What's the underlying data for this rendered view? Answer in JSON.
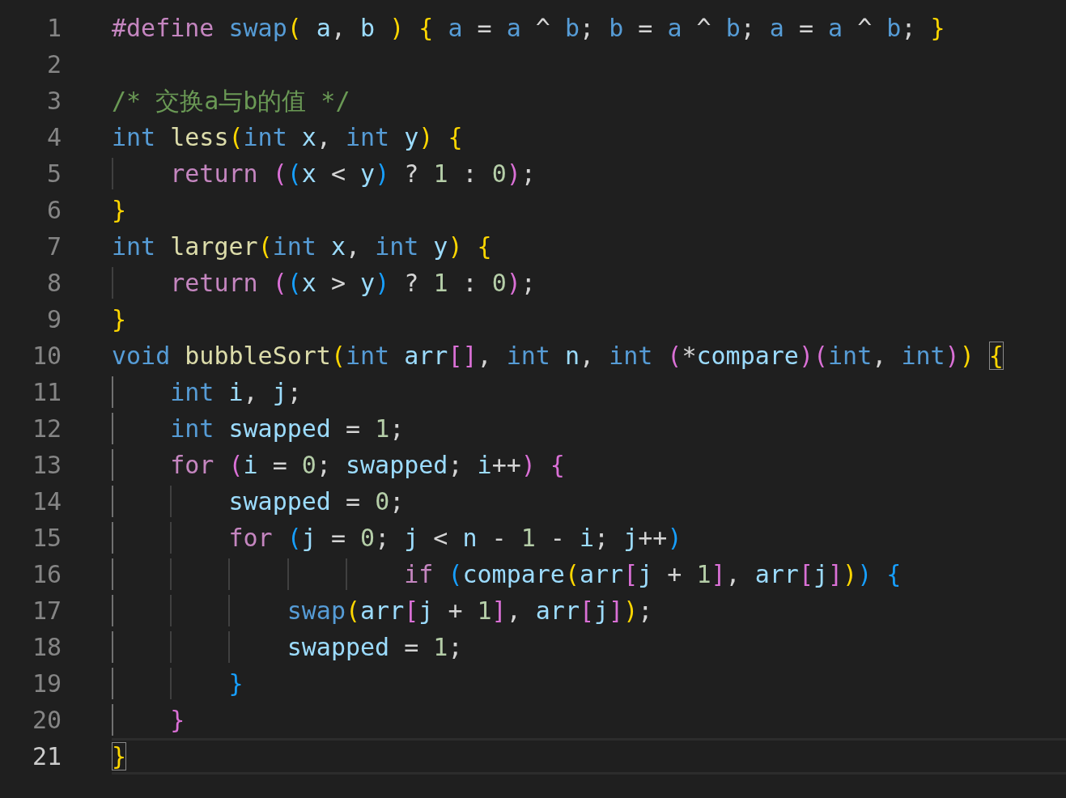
{
  "editor": {
    "lines": [
      {
        "number": "1",
        "current": false,
        "tokens": [
          {
            "text": "#define",
            "kind": "control"
          },
          {
            "text": " swap",
            "kind": "macro"
          },
          {
            "text": "(",
            "kind": "bracket1"
          },
          {
            "text": " a",
            "kind": "var"
          },
          {
            "text": ", ",
            "kind": "plain"
          },
          {
            "text": "b",
            "kind": "var"
          },
          {
            "text": " )",
            "kind": "bracket1"
          },
          {
            "text": " {",
            "kind": "bracket1"
          },
          {
            "text": " a",
            "kind": "macro"
          },
          {
            "text": " = ",
            "kind": "plain"
          },
          {
            "text": "a",
            "kind": "macro"
          },
          {
            "text": " ^ ",
            "kind": "plain"
          },
          {
            "text": "b",
            "kind": "macro"
          },
          {
            "text": "; ",
            "kind": "plain"
          },
          {
            "text": "b",
            "kind": "macro"
          },
          {
            "text": " = ",
            "kind": "plain"
          },
          {
            "text": "a",
            "kind": "macro"
          },
          {
            "text": " ^ ",
            "kind": "plain"
          },
          {
            "text": "b",
            "kind": "macro"
          },
          {
            "text": "; ",
            "kind": "plain"
          },
          {
            "text": "a",
            "kind": "macro"
          },
          {
            "text": " = ",
            "kind": "plain"
          },
          {
            "text": "a",
            "kind": "macro"
          },
          {
            "text": " ^ ",
            "kind": "plain"
          },
          {
            "text": "b",
            "kind": "macro"
          },
          {
            "text": "; ",
            "kind": "plain"
          },
          {
            "text": "}",
            "kind": "bracket1"
          }
        ]
      },
      {
        "number": "2",
        "current": false
      },
      {
        "number": "3",
        "current": false,
        "tokens": [
          {
            "text": "/* 交换a与b的值 */",
            "kind": "comment"
          }
        ]
      },
      {
        "number": "4",
        "current": false,
        "tokens": [
          {
            "text": "int",
            "kind": "keyword"
          },
          {
            "text": " less",
            "kind": "function"
          },
          {
            "text": "(",
            "kind": "bracket1"
          },
          {
            "text": "int",
            "kind": "keyword"
          },
          {
            "text": " x",
            "kind": "var"
          },
          {
            "text": ", ",
            "kind": "plain"
          },
          {
            "text": "int",
            "kind": "keyword"
          },
          {
            "text": " y",
            "kind": "var"
          },
          {
            "text": ")",
            "kind": "bracket1"
          },
          {
            "text": " {",
            "kind": "bracket1"
          }
        ]
      },
      {
        "number": "5",
        "current": false,
        "guides": [
          {
            "active": false
          }
        ],
        "tokens": [
          {
            "text": "    return",
            "kind": "control"
          },
          {
            "text": " (",
            "kind": "bracket2"
          },
          {
            "text": "(",
            "kind": "bracket3"
          },
          {
            "text": "x",
            "kind": "var"
          },
          {
            "text": " < ",
            "kind": "plain"
          },
          {
            "text": "y",
            "kind": "var"
          },
          {
            "text": ")",
            "kind": "bracket3"
          },
          {
            "text": " ? ",
            "kind": "plain"
          },
          {
            "text": "1",
            "kind": "number"
          },
          {
            "text": " : ",
            "kind": "plain"
          },
          {
            "text": "0",
            "kind": "number"
          },
          {
            "text": ")",
            "kind": "bracket2"
          },
          {
            "text": ";",
            "kind": "plain"
          }
        ]
      },
      {
        "number": "6",
        "current": false,
        "tokens": [
          {
            "text": "}",
            "kind": "bracket1"
          }
        ]
      },
      {
        "number": "7",
        "current": false,
        "tokens": [
          {
            "text": "int",
            "kind": "keyword"
          },
          {
            "text": " larger",
            "kind": "function"
          },
          {
            "text": "(",
            "kind": "bracket1"
          },
          {
            "text": "int",
            "kind": "keyword"
          },
          {
            "text": " x",
            "kind": "var"
          },
          {
            "text": ", ",
            "kind": "plain"
          },
          {
            "text": "int",
            "kind": "keyword"
          },
          {
            "text": " y",
            "kind": "var"
          },
          {
            "text": ")",
            "kind": "bracket1"
          },
          {
            "text": " {",
            "kind": "bracket1"
          }
        ]
      },
      {
        "number": "8",
        "current": false,
        "guides": [
          {
            "active": false
          }
        ],
        "tokens": [
          {
            "text": "    return",
            "kind": "control"
          },
          {
            "text": " (",
            "kind": "bracket2"
          },
          {
            "text": "(",
            "kind": "bracket3"
          },
          {
            "text": "x",
            "kind": "var"
          },
          {
            "text": " > ",
            "kind": "plain"
          },
          {
            "text": "y",
            "kind": "var"
          },
          {
            "text": ")",
            "kind": "bracket3"
          },
          {
            "text": " ? ",
            "kind": "plain"
          },
          {
            "text": "1",
            "kind": "number"
          },
          {
            "text": " : ",
            "kind": "plain"
          },
          {
            "text": "0",
            "kind": "number"
          },
          {
            "text": ")",
            "kind": "bracket2"
          },
          {
            "text": ";",
            "kind": "plain"
          }
        ]
      },
      {
        "number": "9",
        "current": false,
        "tokens": [
          {
            "text": "}",
            "kind": "bracket1"
          }
        ]
      },
      {
        "number": "10",
        "current": false,
        "tokens": [
          {
            "text": "void",
            "kind": "keyword"
          },
          {
            "text": " bubbleSort",
            "kind": "function"
          },
          {
            "text": "(",
            "kind": "bracket1"
          },
          {
            "text": "int",
            "kind": "keyword"
          },
          {
            "text": " arr",
            "kind": "var"
          },
          {
            "text": "[]",
            "kind": "bracket2"
          },
          {
            "text": ", ",
            "kind": "plain"
          },
          {
            "text": "int",
            "kind": "keyword"
          },
          {
            "text": " n",
            "kind": "var"
          },
          {
            "text": ", ",
            "kind": "plain"
          },
          {
            "text": "int",
            "kind": "keyword"
          },
          {
            "text": " (",
            "kind": "bracket2"
          },
          {
            "text": "*",
            "kind": "plain"
          },
          {
            "text": "compare",
            "kind": "var"
          },
          {
            "text": ")",
            "kind": "bracket2"
          },
          {
            "text": "(",
            "kind": "bracket2"
          },
          {
            "text": "int",
            "kind": "keyword"
          },
          {
            "text": ", ",
            "kind": "plain"
          },
          {
            "text": "int",
            "kind": "keyword"
          },
          {
            "text": ")",
            "kind": "bracket2"
          },
          {
            "text": ") ",
            "kind": "bracket1"
          },
          {
            "text": "{",
            "kind": "bracket1",
            "matched": true
          }
        ]
      },
      {
        "number": "11",
        "current": false,
        "guides": [
          {
            "active": true
          }
        ],
        "tokens": [
          {
            "text": "    int",
            "kind": "keyword"
          },
          {
            "text": " i",
            "kind": "var"
          },
          {
            "text": ", ",
            "kind": "plain"
          },
          {
            "text": "j",
            "kind": "var"
          },
          {
            "text": ";",
            "kind": "plain"
          }
        ]
      },
      {
        "number": "12",
        "current": false,
        "guides": [
          {
            "active": true
          }
        ],
        "tokens": [
          {
            "text": "    int",
            "kind": "keyword"
          },
          {
            "text": " swapped",
            "kind": "var"
          },
          {
            "text": " = ",
            "kind": "plain"
          },
          {
            "text": "1",
            "kind": "number"
          },
          {
            "text": ";",
            "kind": "plain"
          }
        ]
      },
      {
        "number": "13",
        "current": false,
        "guides": [
          {
            "active": true
          }
        ],
        "tokens": [
          {
            "text": "    for",
            "kind": "control"
          },
          {
            "text": " (",
            "kind": "bracket2"
          },
          {
            "text": "i",
            "kind": "var"
          },
          {
            "text": " = ",
            "kind": "plain"
          },
          {
            "text": "0",
            "kind": "number"
          },
          {
            "text": "; ",
            "kind": "plain"
          },
          {
            "text": "swapped",
            "kind": "var"
          },
          {
            "text": "; ",
            "kind": "plain"
          },
          {
            "text": "i",
            "kind": "var"
          },
          {
            "text": "++",
            "kind": "plain"
          },
          {
            "text": ")",
            "kind": "bracket2"
          },
          {
            "text": " {",
            "kind": "bracket2"
          }
        ]
      },
      {
        "number": "14",
        "current": false,
        "guides": [
          {
            "active": true
          },
          {
            "active": false
          }
        ],
        "tokens": [
          {
            "text": "        swapped",
            "kind": "var"
          },
          {
            "text": " = ",
            "kind": "plain"
          },
          {
            "text": "0",
            "kind": "number"
          },
          {
            "text": ";",
            "kind": "plain"
          }
        ]
      },
      {
        "number": "15",
        "current": false,
        "guides": [
          {
            "active": true
          },
          {
            "active": false
          }
        ],
        "tokens": [
          {
            "text": "        for",
            "kind": "control"
          },
          {
            "text": " (",
            "kind": "bracket3"
          },
          {
            "text": "j",
            "kind": "var"
          },
          {
            "text": " = ",
            "kind": "plain"
          },
          {
            "text": "0",
            "kind": "number"
          },
          {
            "text": "; ",
            "kind": "plain"
          },
          {
            "text": "j",
            "kind": "var"
          },
          {
            "text": " < ",
            "kind": "plain"
          },
          {
            "text": "n",
            "kind": "var"
          },
          {
            "text": " - ",
            "kind": "plain"
          },
          {
            "text": "1",
            "kind": "number"
          },
          {
            "text": " - ",
            "kind": "plain"
          },
          {
            "text": "i",
            "kind": "var"
          },
          {
            "text": "; ",
            "kind": "plain"
          },
          {
            "text": "j",
            "kind": "var"
          },
          {
            "text": "++",
            "kind": "plain"
          },
          {
            "text": ")",
            "kind": "bracket3"
          }
        ]
      },
      {
        "number": "16",
        "current": false,
        "guides": [
          {
            "active": true
          },
          {
            "active": false
          },
          {
            "active": false
          },
          {
            "active": false
          },
          {
            "active": false
          }
        ],
        "tokens": [
          {
            "text": "                    if",
            "kind": "control"
          },
          {
            "text": " (",
            "kind": "bracket3"
          },
          {
            "text": "compare",
            "kind": "var"
          },
          {
            "text": "(",
            "kind": "bracket1"
          },
          {
            "text": "arr",
            "kind": "var"
          },
          {
            "text": "[",
            "kind": "bracket2"
          },
          {
            "text": "j",
            "kind": "var"
          },
          {
            "text": " + ",
            "kind": "plain"
          },
          {
            "text": "1",
            "kind": "number"
          },
          {
            "text": "]",
            "kind": "bracket2"
          },
          {
            "text": ", ",
            "kind": "plain"
          },
          {
            "text": "arr",
            "kind": "var"
          },
          {
            "text": "[",
            "kind": "bracket2"
          },
          {
            "text": "j",
            "kind": "var"
          },
          {
            "text": "]",
            "kind": "bracket2"
          },
          {
            "text": ")",
            "kind": "bracket1"
          },
          {
            "text": ")",
            "kind": "bracket3"
          },
          {
            "text": " {",
            "kind": "bracket3"
          }
        ]
      },
      {
        "number": "17",
        "current": false,
        "guides": [
          {
            "active": true
          },
          {
            "active": false
          },
          {
            "active": false
          }
        ],
        "tokens": [
          {
            "text": "            swap",
            "kind": "macro"
          },
          {
            "text": "(",
            "kind": "bracket1"
          },
          {
            "text": "arr",
            "kind": "var"
          },
          {
            "text": "[",
            "kind": "bracket2"
          },
          {
            "text": "j",
            "kind": "var"
          },
          {
            "text": " + ",
            "kind": "plain"
          },
          {
            "text": "1",
            "kind": "number"
          },
          {
            "text": "]",
            "kind": "bracket2"
          },
          {
            "text": ", ",
            "kind": "plain"
          },
          {
            "text": "arr",
            "kind": "var"
          },
          {
            "text": "[",
            "kind": "bracket2"
          },
          {
            "text": "j",
            "kind": "var"
          },
          {
            "text": "]",
            "kind": "bracket2"
          },
          {
            "text": ")",
            "kind": "bracket1"
          },
          {
            "text": ";",
            "kind": "plain"
          }
        ]
      },
      {
        "number": "18",
        "current": false,
        "guides": [
          {
            "active": true
          },
          {
            "active": false
          },
          {
            "active": false
          }
        ],
        "tokens": [
          {
            "text": "            swapped",
            "kind": "var"
          },
          {
            "text": " = ",
            "kind": "plain"
          },
          {
            "text": "1",
            "kind": "number"
          },
          {
            "text": ";",
            "kind": "plain"
          }
        ]
      },
      {
        "number": "19",
        "current": false,
        "guides": [
          {
            "active": true
          },
          {
            "active": false
          }
        ],
        "tokens": [
          {
            "text": "        }",
            "kind": "bracket3"
          }
        ]
      },
      {
        "number": "20",
        "current": false,
        "guides": [
          {
            "active": true
          }
        ],
        "tokens": [
          {
            "text": "    }",
            "kind": "bracket2"
          }
        ]
      },
      {
        "number": "21",
        "current": true,
        "tokens": [
          {
            "text": "}",
            "kind": "bracket1",
            "matched": true
          }
        ]
      }
    ]
  }
}
